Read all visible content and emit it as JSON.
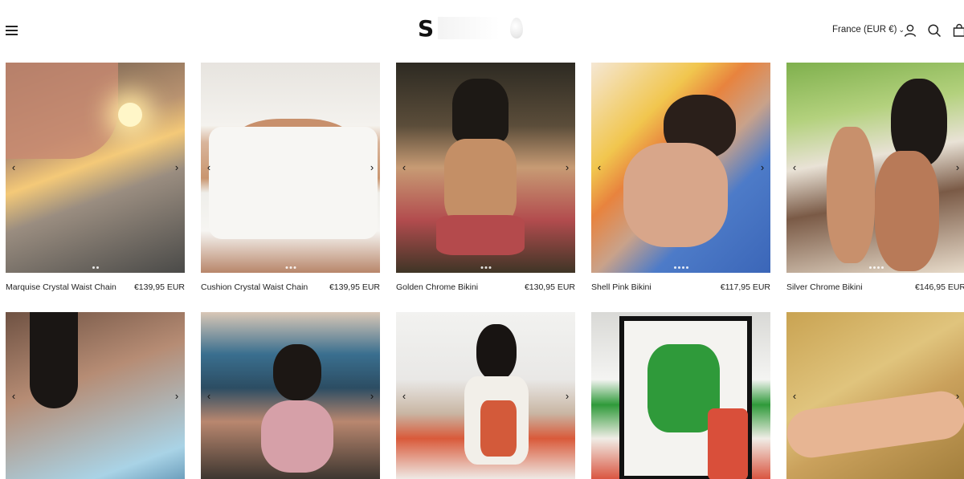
{
  "header": {
    "logo_text": "S",
    "country_selector": "France (EUR €)",
    "icons": [
      "menu-icon",
      "account-icon",
      "search-icon",
      "cart-icon"
    ]
  },
  "products_row1": [
    {
      "name": "Marquise Crystal Waist Chain",
      "price": "€139,95 EUR",
      "dots": 2
    },
    {
      "name": "Cushion Crystal Waist Chain",
      "price": "€139,95 EUR",
      "dots": 3
    },
    {
      "name": "Golden Chrome Bikini",
      "price": "€130,95 EUR",
      "dots": 3
    },
    {
      "name": "Shell Pink Bikini",
      "price": "€117,95 EUR",
      "dots": 4
    },
    {
      "name": "Silver Chrome Bikini",
      "price": "€146,95 EUR",
      "dots": 4
    }
  ],
  "arrows": {
    "prev": "‹",
    "next": "›"
  }
}
